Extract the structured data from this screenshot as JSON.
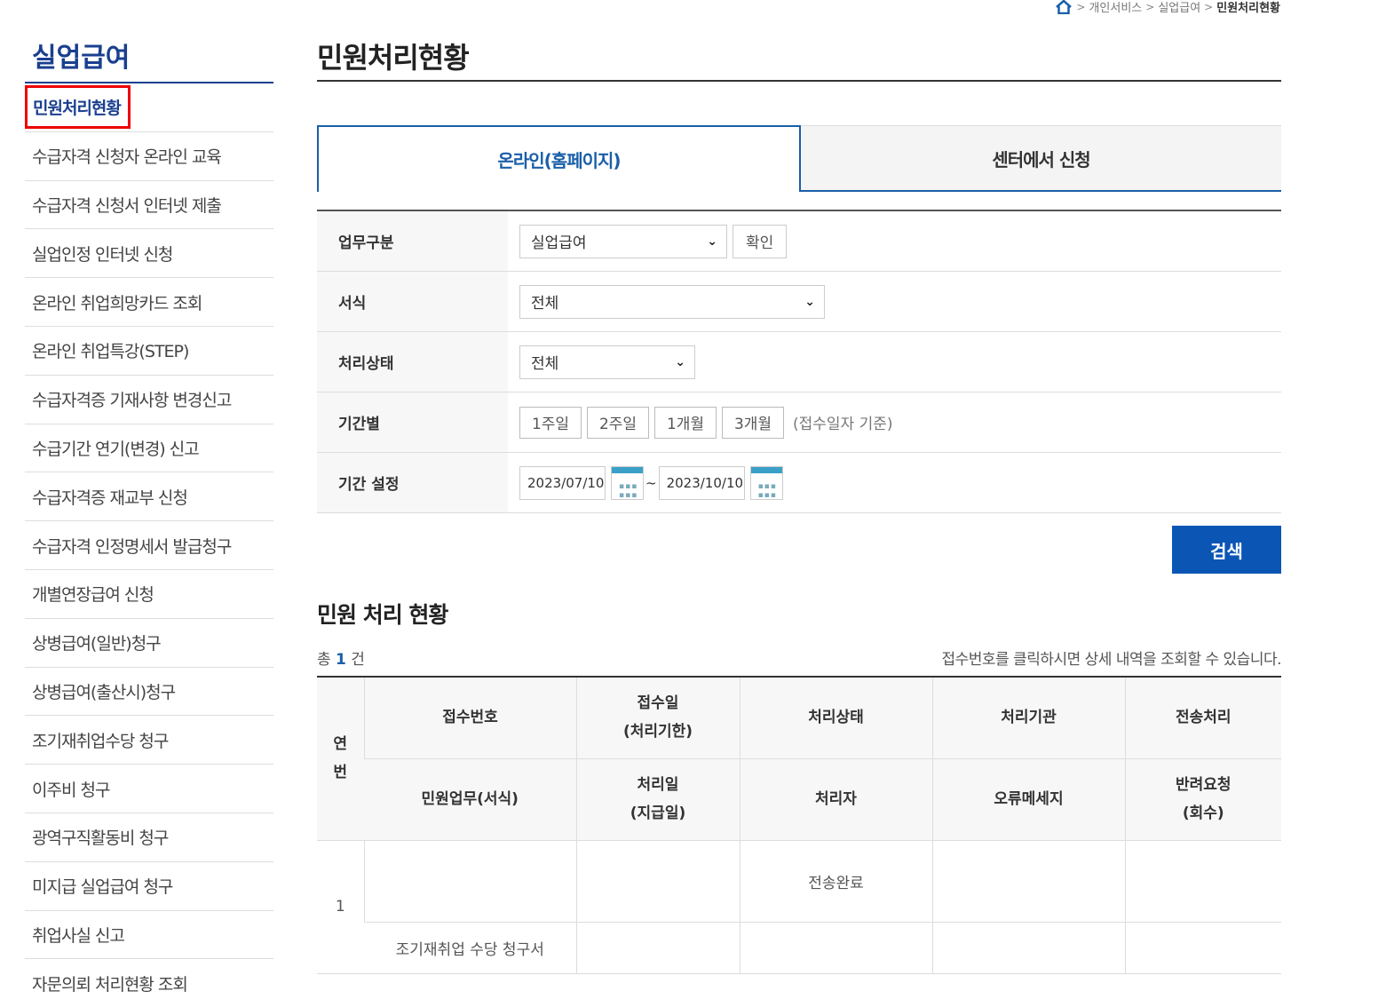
{
  "breadcrumb": {
    "items": [
      "개인서비스",
      "실업급여"
    ],
    "current": "민원처리현황"
  },
  "sidebar": {
    "title": "실업급여",
    "items": [
      {
        "label": "민원처리현황"
      },
      {
        "label": "수급자격 신청자 온라인 교육"
      },
      {
        "label": "수급자격 신청서 인터넷 제출"
      },
      {
        "label": "실업인정 인터넷 신청"
      },
      {
        "label": "온라인 취업희망카드 조회"
      },
      {
        "label": "온라인 취업특강(STEP)"
      },
      {
        "label": "수급자격증 기재사항 변경신고"
      },
      {
        "label": "수급기간 연기(변경) 신고"
      },
      {
        "label": "수급자격증 재교부 신청"
      },
      {
        "label": "수급자격 인정명세서 발급청구"
      },
      {
        "label": "개별연장급여 신청"
      },
      {
        "label": "상병급여(일반)청구"
      },
      {
        "label": "상병급여(출산시)청구"
      },
      {
        "label": "조기재취업수당 청구"
      },
      {
        "label": "이주비 청구"
      },
      {
        "label": "광역구직활동비 청구"
      },
      {
        "label": "미지급 실업급여 청구"
      },
      {
        "label": "취업사실 신고"
      },
      {
        "label": "자문의뢰 처리현황 조회"
      }
    ]
  },
  "main": {
    "title": "민원처리현황",
    "tabs": [
      {
        "label": "온라인(홈페이지)"
      },
      {
        "label": "센터에서 신청"
      }
    ],
    "form": {
      "work_type": {
        "label": "업무구분",
        "value": "실업급여",
        "confirm": "확인"
      },
      "form_type": {
        "label": "서식",
        "value": "전체"
      },
      "status": {
        "label": "처리상태",
        "value": "전체"
      },
      "period": {
        "label": "기간별",
        "buttons": [
          "1주일",
          "2주일",
          "1개월",
          "3개월"
        ],
        "note": "(접수일자 기준)"
      },
      "date_range": {
        "label": "기간 설정",
        "start": "2023/07/10",
        "tilde": "~",
        "end": "2023/10/10"
      }
    },
    "search_label": "검색",
    "results": {
      "title": "민원 처리 현황",
      "count_prefix": "총",
      "count": "1",
      "count_suffix": "건",
      "hint": "접수번호를 클릭하시면 상세 내역을 조회할 수 있습니다.",
      "headers": {
        "no": "연\n번",
        "receipt_no": "접수번호",
        "receipt_date": "접수일\n(처리기한)",
        "status": "처리상태",
        "agency": "처리기관",
        "transmit": "전송처리",
        "task": "민원업무(서식)",
        "process_date": "처리일\n(지급일)",
        "handler": "처리자",
        "error": "오류메세지",
        "return_req": "반려요청\n(회수)"
      },
      "rows": [
        {
          "no": "1",
          "status": "전송완료",
          "task": "조기재취업 수당 청구서"
        }
      ]
    }
  }
}
